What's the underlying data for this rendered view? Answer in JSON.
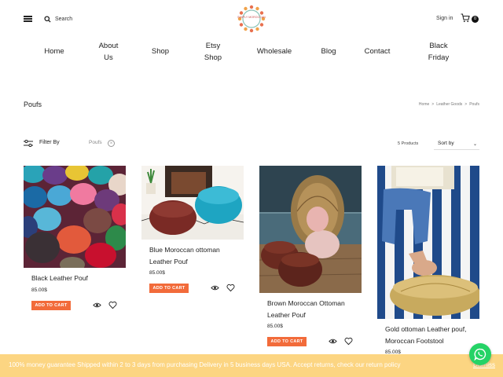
{
  "header": {
    "search_label": "Search",
    "logo_text": "SIMPLY MOROCCAN",
    "signin_label": "Sign in",
    "cart_count": "0"
  },
  "nav": {
    "home": "Home",
    "about_l1": "About",
    "about_l2": "Us",
    "shop": "Shop",
    "etsy_l1": "Etsy",
    "etsy_l2": "Shop",
    "wholesale": "Wholesale",
    "blog": "Blog",
    "contact": "Contact",
    "black_l1": "Black",
    "black_l2": "Friday"
  },
  "page": {
    "title": "Poufs",
    "breadcrumb": [
      "Home",
      ">",
      "Leather Goods",
      ">",
      "Poufs"
    ]
  },
  "toolbar": {
    "filter_label": "Filter By",
    "active_filter": "Poufs",
    "clear_icon": "×",
    "product_count": "5 Products",
    "sort_label": "Sort by",
    "sort_chevron": "⌄"
  },
  "products": [
    {
      "name_l1": "Black Leather Pouf",
      "name_l2": "",
      "price": "85.00$",
      "add_label": "ADD TO CART"
    },
    {
      "name_l1": "Blue Moroccan ottoman",
      "name_l2": "Leather Pouf",
      "price": "85.00$",
      "add_label": "ADD TO CART"
    },
    {
      "name_l1": "Brown Moroccan Ottoman",
      "name_l2": "Leather Pouf",
      "price": "85.00$",
      "add_label": "ADD TO CART"
    },
    {
      "name_l1": "Gold ottoman Leather pouf,",
      "name_l2": "Moroccan Footstool",
      "price": "85.00$",
      "add_label": "ADD TO CART"
    }
  ],
  "promo": {
    "text": "100% money guarantee Shipped within 2 to 3 days from purchasing Delivery in 5 business days USA. Accept returns, check our return policy",
    "dismiss": "Dismiss"
  },
  "colors": {
    "accent": "#f26b3a",
    "promo_bg": "#fcd278",
    "whatsapp": "#25d366"
  }
}
